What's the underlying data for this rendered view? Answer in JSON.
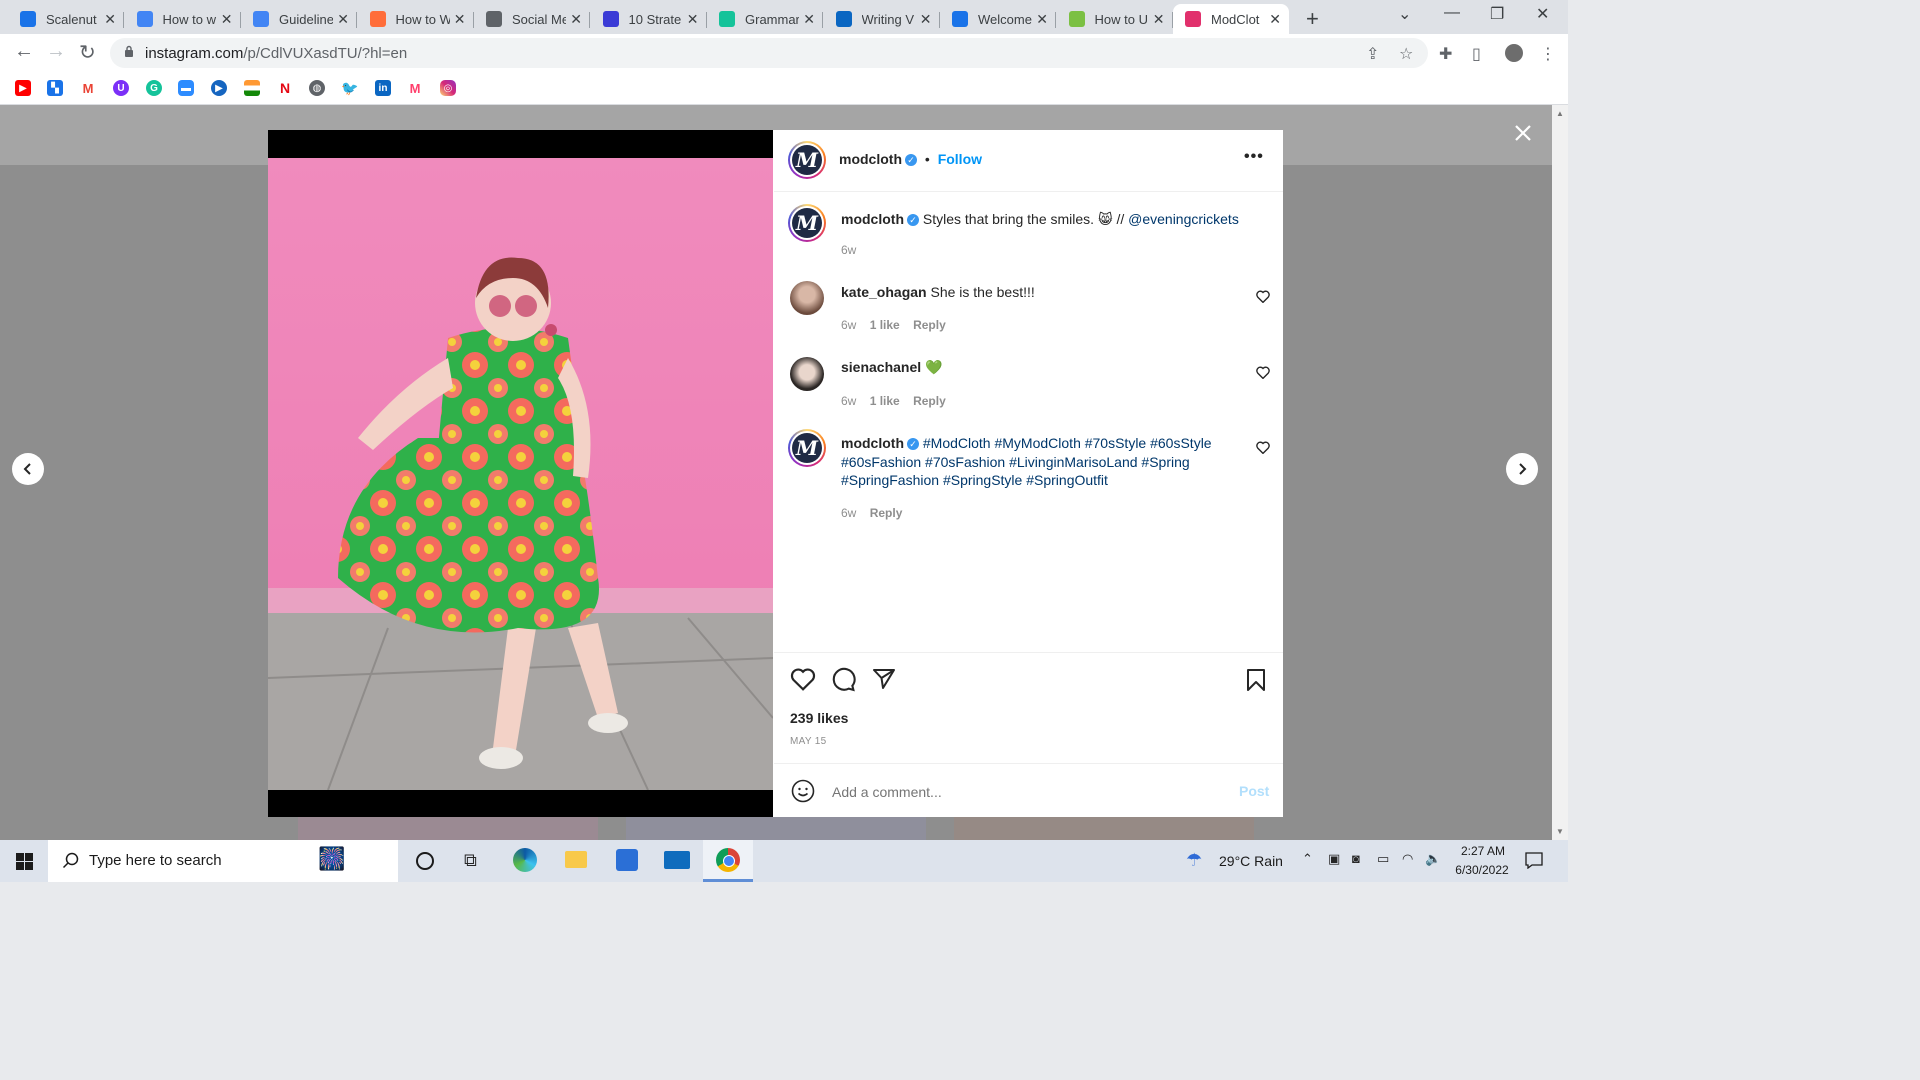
{
  "browser": {
    "tabs": [
      {
        "title": "Scalenut",
        "icon": "scalenut-icon",
        "color": "#1a73e8"
      },
      {
        "title": "How to w",
        "icon": "docs-icon",
        "color": "#4285f4"
      },
      {
        "title": "Guideline",
        "icon": "docs-icon",
        "color": "#4285f4"
      },
      {
        "title": "How to W",
        "icon": "orange-icon",
        "color": "#ff6d3a"
      },
      {
        "title": "Social Me",
        "icon": "eic-icon",
        "color": "#5f6368"
      },
      {
        "title": "10 Strate",
        "icon": "compass-icon",
        "color": "#3b3bd6"
      },
      {
        "title": "Grammar",
        "icon": "grammarly-icon",
        "color": "#15c39a"
      },
      {
        "title": "Writing V",
        "icon": "linkedin-icon",
        "color": "#0a66c2"
      },
      {
        "title": "Welcome",
        "icon": "scalenut-icon",
        "color": "#1a73e8"
      },
      {
        "title": "How to U",
        "icon": "leaf-icon",
        "color": "#7bc043"
      },
      {
        "title": "ModClot",
        "icon": "instagram-icon",
        "color": "#e1306c"
      }
    ],
    "url_host": "instagram.com",
    "url_path": "/p/CdlVUXasdTU/?hl=en",
    "bookmarks": [
      "youtube-icon",
      "scalenut-icon",
      "gmail-icon",
      "u-icon",
      "grammarly-icon",
      "zoom-icon",
      "play-icon",
      "india-flag-icon",
      "netflix-icon",
      "globe-icon",
      "twitter-icon",
      "linkedin-icon",
      "myntra-icon",
      "instagram-icon"
    ]
  },
  "post": {
    "header_user": "modcloth",
    "follow_label": "Follow",
    "caption": {
      "user": "modcloth",
      "text": "Styles that bring the smiles. 😸 // ",
      "mention": "@eveningcrickets",
      "time": "6w"
    },
    "comments": [
      {
        "user": "kate_ohagan",
        "text": "She is the best!!!",
        "time": "6w",
        "likes": "1 like",
        "reply": "Reply"
      },
      {
        "user": "sienachanel",
        "text": "💚",
        "time": "6w",
        "likes": "1 like",
        "reply": "Reply"
      },
      {
        "user": "modcloth",
        "text": "#ModCloth #MyModCloth #70sStyle #60sStyle #60sFashion #70sFashion #LivinginMarisoLand #Spring #SpringFashion #SpringStyle #SpringOutfit",
        "time": "6w",
        "likes": "",
        "reply": "Reply"
      }
    ],
    "likes": "239 likes",
    "date": "MAY 15",
    "comment_placeholder": "Add a comment...",
    "post_button": "Post"
  },
  "taskbar": {
    "search_placeholder": "Type here to search",
    "weather": "29°C  Rain",
    "time": "2:27 AM",
    "date": "6/30/2022"
  },
  "colors": {
    "instagram_blue": "#0095f6",
    "page_overlay": "#8e8e8e",
    "wall_pink": "#f287b8",
    "dress_green": "#2fb14a"
  }
}
